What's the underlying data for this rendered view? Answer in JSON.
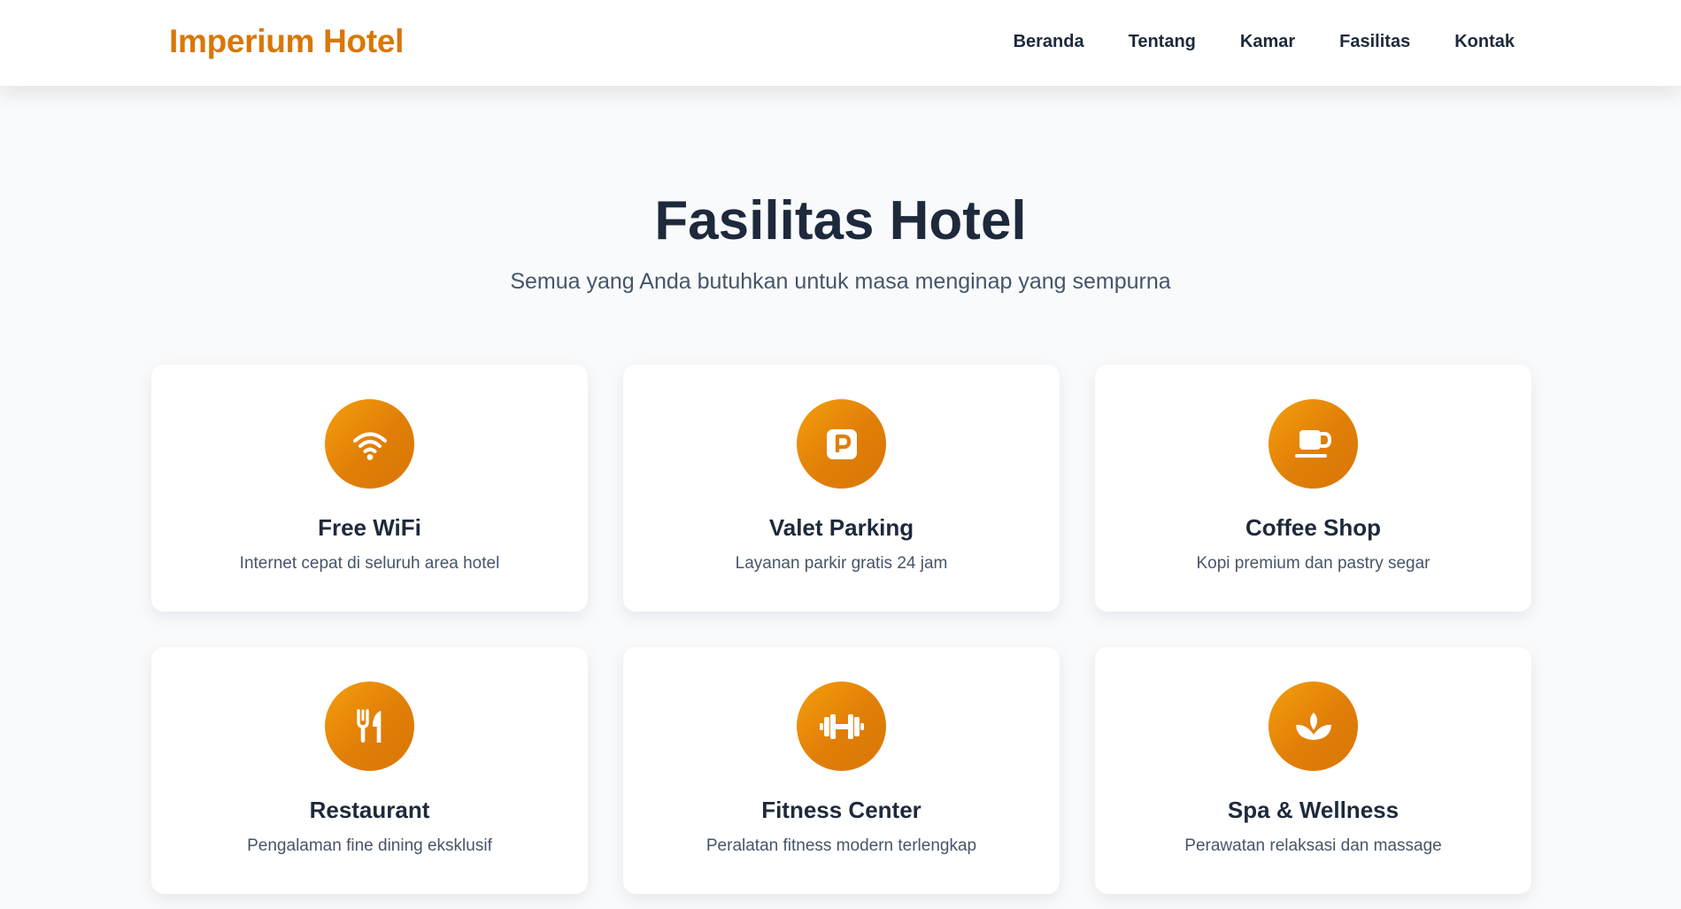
{
  "header": {
    "brand": "Imperium Hotel",
    "nav": [
      "Beranda",
      "Tentang",
      "Kamar",
      "Fasilitas",
      "Kontak"
    ]
  },
  "section": {
    "title": "Fasilitas Hotel",
    "subtitle": "Semua yang Anda butuhkan untuk masa menginap yang sempurna"
  },
  "facilities": [
    {
      "icon": "wifi-icon",
      "title": "Free WiFi",
      "description": "Internet cepat di seluruh area hotel"
    },
    {
      "icon": "parking-icon",
      "title": "Valet Parking",
      "description": "Layanan parkir gratis 24 jam"
    },
    {
      "icon": "coffee-cup-icon",
      "title": "Coffee Shop",
      "description": "Kopi premium dan pastry segar"
    },
    {
      "icon": "utensils-icon",
      "title": "Restaurant",
      "description": "Pengalaman fine dining eksklusif"
    },
    {
      "icon": "dumbbell-icon",
      "title": "Fitness Center",
      "description": "Peralatan fitness modern terlengkap"
    },
    {
      "icon": "spa-lotus-icon",
      "title": "Spa & Wellness",
      "description": "Perawatan relaksasi dan massage"
    }
  ],
  "colors": {
    "accent": "#d97706",
    "accent_light": "#f59e0b",
    "text_dark": "#1e293b",
    "text_muted": "#475569",
    "background": "#f8fafc"
  }
}
